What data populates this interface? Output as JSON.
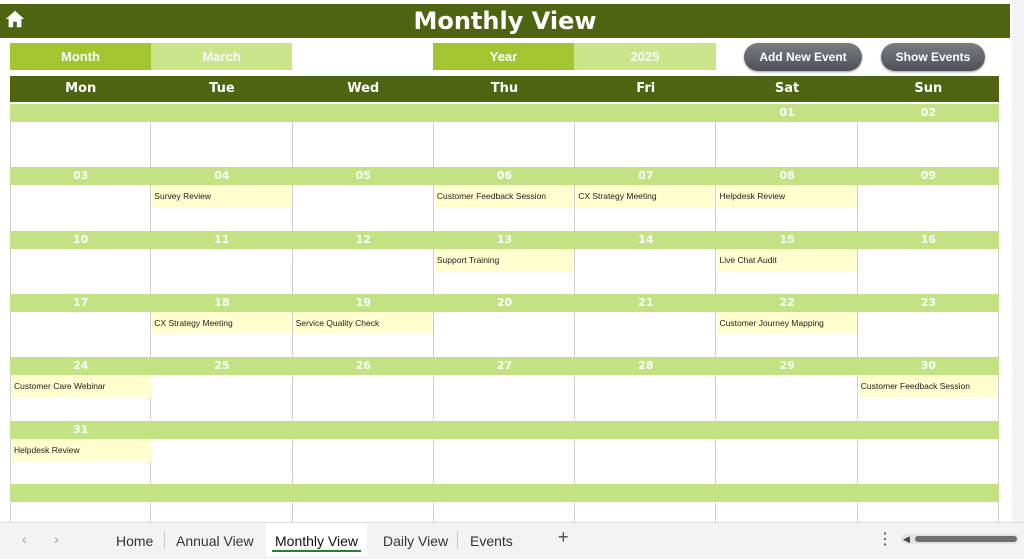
{
  "header": {
    "title": "Monthly View"
  },
  "controls": {
    "month_label": "Month",
    "month_value": "March",
    "year_label": "Year",
    "year_value": "2025"
  },
  "buttons": {
    "add_event": "Add New Event",
    "show_events": "Show Events"
  },
  "days": [
    "Mon",
    "Tue",
    "Wed",
    "Thu",
    "Fri",
    "Sat",
    "Sun"
  ],
  "weeks": [
    {
      "dates": [
        "",
        "",
        "",
        "",
        "",
        "01",
        "02"
      ],
      "events": [
        "",
        "",
        "",
        "",
        "",
        "",
        ""
      ]
    },
    {
      "dates": [
        "03",
        "04",
        "05",
        "06",
        "07",
        "08",
        "09"
      ],
      "events": [
        "",
        "Survey Review",
        "",
        "Customer Feedback Session",
        "CX Strategy Meeting",
        "Helpdesk Review",
        ""
      ]
    },
    {
      "dates": [
        "10",
        "11",
        "12",
        "13",
        "14",
        "15",
        "16"
      ],
      "events": [
        "",
        "",
        "",
        "Support Training",
        "",
        "Live Chat Audit",
        ""
      ]
    },
    {
      "dates": [
        "17",
        "18",
        "19",
        "20",
        "21",
        "22",
        "23"
      ],
      "events": [
        "",
        "CX Strategy Meeting",
        "Service Quality Check",
        "",
        "",
        "Customer Journey Mapping",
        ""
      ]
    },
    {
      "dates": [
        "24",
        "25",
        "26",
        "27",
        "28",
        "29",
        "30"
      ],
      "events": [
        "Customer Care Webinar",
        "",
        "",
        "",
        "",
        "",
        "Customer Feedback Session"
      ]
    },
    {
      "dates": [
        "31",
        "",
        "",
        "",
        "",
        "",
        ""
      ],
      "events": [
        "Helpdesk Review",
        "",
        "",
        "",
        "",
        "",
        ""
      ]
    },
    {
      "dates": [
        "",
        "",
        "",
        "",
        "",
        "",
        ""
      ],
      "events": [
        "",
        "",
        "",
        "",
        "",
        "",
        ""
      ]
    }
  ],
  "sheet_tabs": [
    {
      "label": "Home",
      "active": false
    },
    {
      "label": "Annual View",
      "active": false
    },
    {
      "label": "Monthly View",
      "active": true
    },
    {
      "label": "Daily View",
      "active": false
    },
    {
      "label": "Events",
      "active": false
    }
  ],
  "icons": {
    "home": "home-icon",
    "prev": "chevron-left-icon",
    "next": "chevron-right-icon",
    "add_sheet": "plus-icon",
    "more": "more-vertical-icon"
  },
  "colors": {
    "dark_green": "#4e6410",
    "accent_green": "#a2c530",
    "light_green": "#c3e284",
    "event_yellow": "#fffecf"
  }
}
